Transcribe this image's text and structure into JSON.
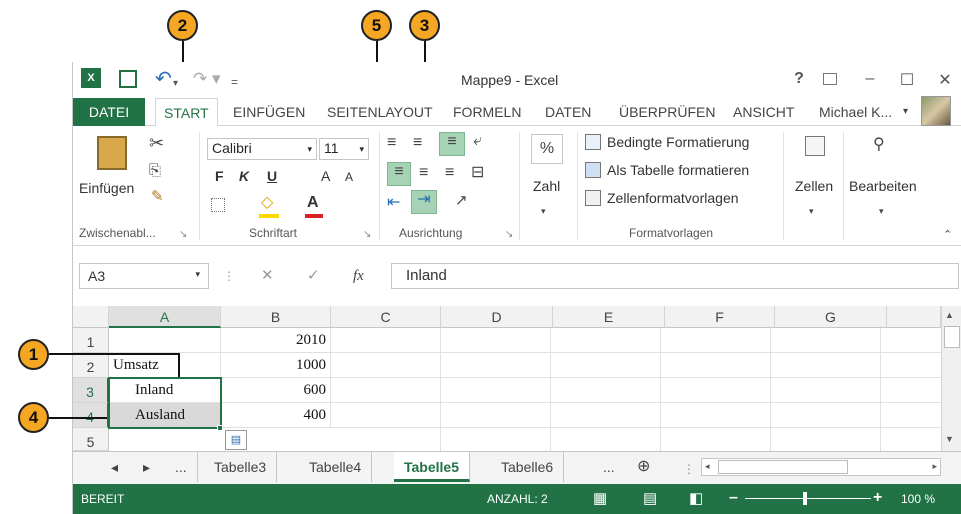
{
  "title_bar": {
    "window_title": "Mappe9 - Excel",
    "help": "?",
    "ribbon_display": "⊼",
    "minimize": "–",
    "restore": "☐",
    "close": "✕",
    "qat_redo": "↷ ▾",
    "qat_customize": "="
  },
  "tabs": [
    "DATEI",
    "START",
    "EINFÜGEN",
    "SEITENLAYOUT",
    "FORMELN",
    "DATEN",
    "ÜBERPRÜFEN",
    "ANSICHT"
  ],
  "user": {
    "name": "Michael K...",
    "dropdown": "▾"
  },
  "ribbon": {
    "clipboard": {
      "paste": "Einfügen",
      "label": "Zwischenabl..."
    },
    "font": {
      "name": "Calibri",
      "size": "11",
      "bold": "F",
      "italic": "K",
      "underline": "U",
      "grow": "A",
      "shrink": "A",
      "label": "Schriftart"
    },
    "alignment": {
      "label": "Ausrichtung"
    },
    "number": {
      "percent": "%",
      "label": "Zahl"
    },
    "styles": {
      "conditional": "Bedingte Formatierung",
      "as_table": "Als Tabelle formatieren",
      "cell_styles": "Zellenformatvorlagen",
      "label": "Formatvorlagen"
    },
    "cells": {
      "label": "Zellen"
    },
    "editing": {
      "label": "Bearbeiten"
    }
  },
  "formula_bar": {
    "name_box": "A3",
    "fx": "fx",
    "cancel": "✕",
    "enter": "✓",
    "value": "Inland"
  },
  "columns": [
    "A",
    "B",
    "C",
    "D",
    "E",
    "F",
    "G"
  ],
  "rows": [
    {
      "n": "1",
      "a": "",
      "b": "2010"
    },
    {
      "n": "2",
      "a": "Umsatz",
      "b": "1000"
    },
    {
      "n": "3",
      "a": "Inland",
      "b": "600"
    },
    {
      "n": "4",
      "a": "Ausland",
      "b": "400"
    },
    {
      "n": "5",
      "a": "",
      "b": ""
    }
  ],
  "sheet_tabs": {
    "prev": "◂",
    "next": "▸",
    "more_left": "...",
    "tabs": [
      "Tabelle3",
      "Tabelle4",
      "Tabelle5",
      "Tabelle6"
    ],
    "more_right": "...",
    "add": "⊕"
  },
  "status": {
    "ready": "BEREIT",
    "count": "ANZAHL: 2",
    "zoom_out": "–",
    "zoom_in": "+",
    "zoom": "100 %"
  },
  "callouts": {
    "c1": "1",
    "c2": "2",
    "c3": "3",
    "c4": "4",
    "c5": "5"
  },
  "colors": {
    "accent": "#217346",
    "callout": "#f5a623",
    "highlight": "#a6d3b5"
  }
}
